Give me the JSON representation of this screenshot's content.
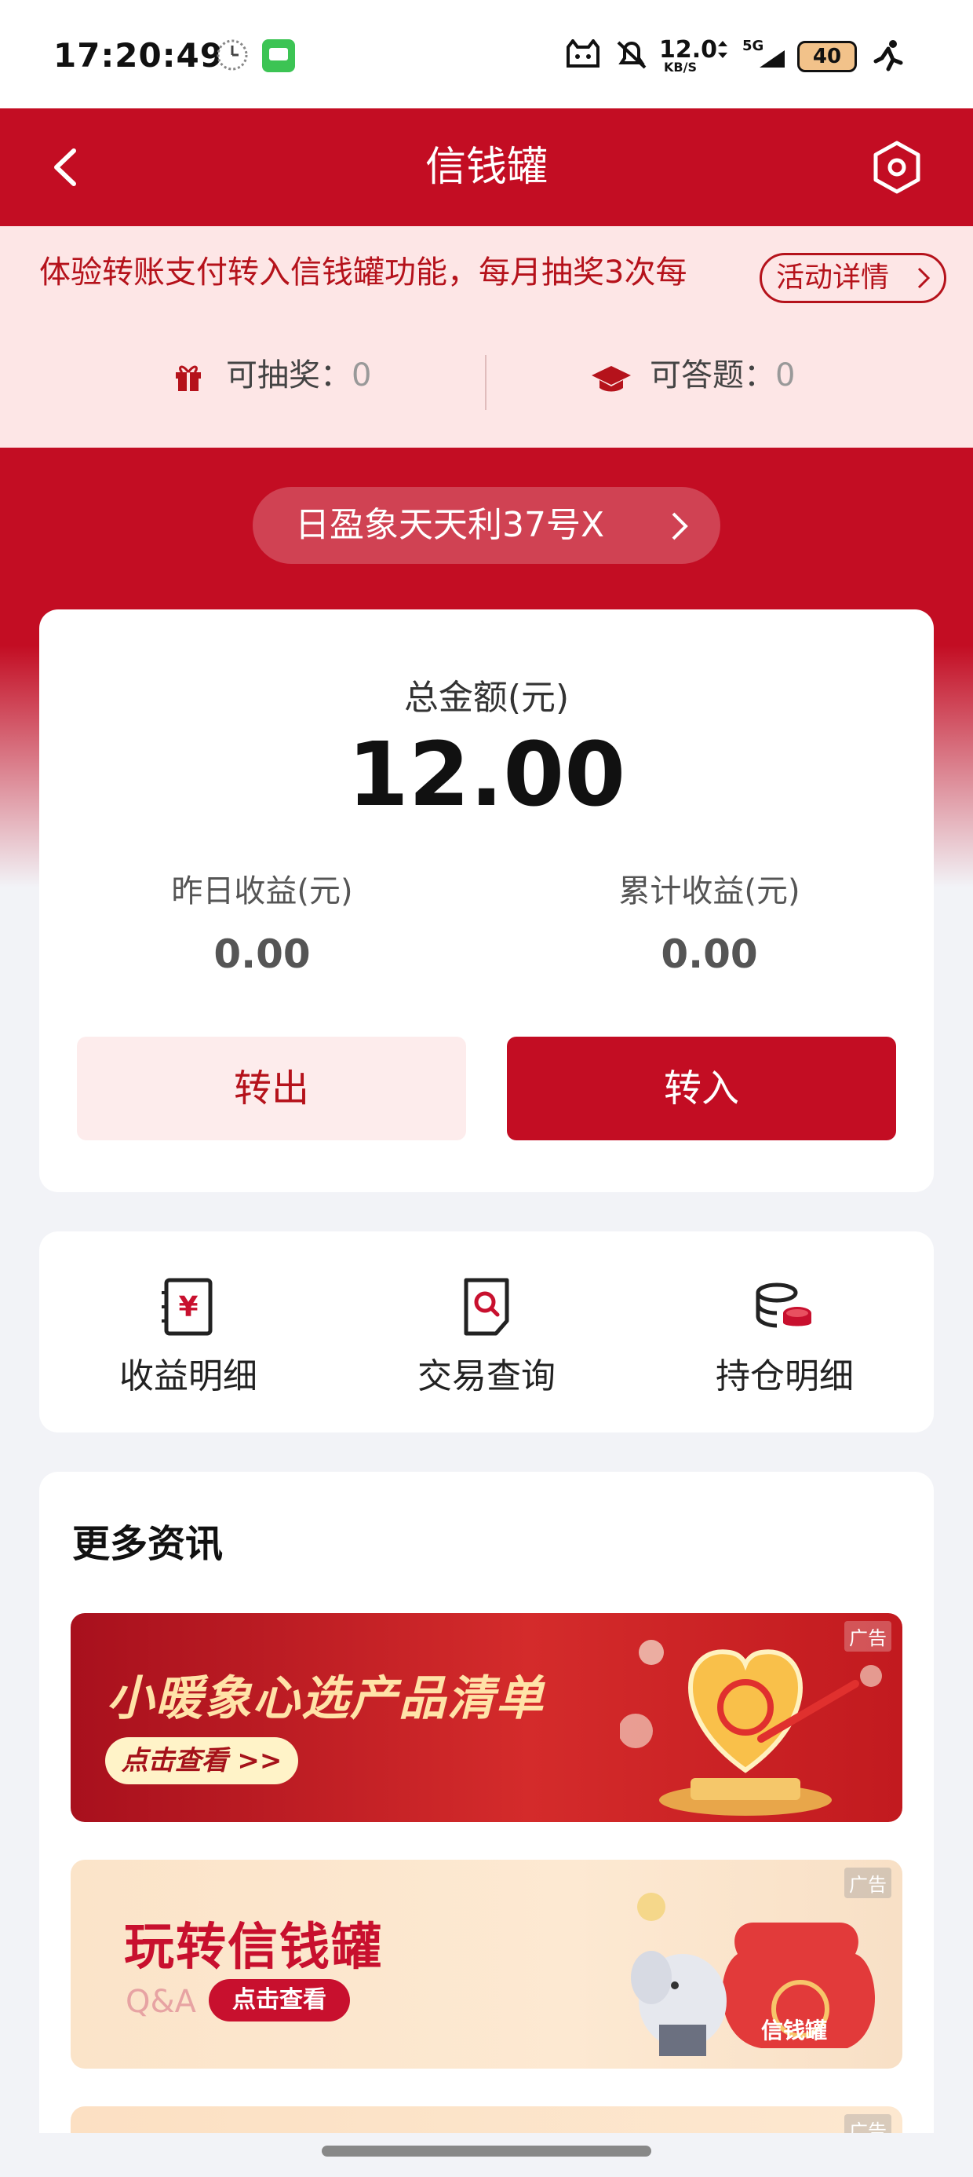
{
  "status_bar": {
    "time": "17:20:49",
    "network_speed": "12.0",
    "network_unit": "KB/S",
    "signal": "5G",
    "battery": "40"
  },
  "header": {
    "title": "信钱罐",
    "back_icon": "chevron-left-icon",
    "settings_icon": "hexagon-settings-icon"
  },
  "promo": {
    "text": "体验转账支付转入信钱罐功能，每月抽奖3次每",
    "details_label": "活动详情",
    "lottery_label": "可抽奖：",
    "lottery_count": "0",
    "quiz_label": "可答题：",
    "quiz_count": "0"
  },
  "product": {
    "name": "日盈象天天利37号X"
  },
  "summary": {
    "total_label": "总金额(元)",
    "total_value": "12.00",
    "yesterday_label": "昨日收益(元)",
    "yesterday_value": "0.00",
    "cumulative_label": "累计收益(元)",
    "cumulative_value": "0.00",
    "transfer_out_label": "转出",
    "transfer_in_label": "转入"
  },
  "tools": [
    {
      "label": "收益明细",
      "icon": "yuan-receipt-icon"
    },
    {
      "label": "交易查询",
      "icon": "search-document-icon"
    },
    {
      "label": "持仓明细",
      "icon": "coins-stack-icon"
    }
  ],
  "news": {
    "title": "更多资讯",
    "banners": [
      {
        "title": "小暖象心选产品清单",
        "button": "点击查看 >>",
        "ad_tag": "广告"
      },
      {
        "title": "玩转信钱罐",
        "subtitle": "Q&A",
        "button": "点击查看",
        "ad_tag": "广告",
        "badge": "信钱罐"
      },
      {
        "ad_tag": "广告"
      }
    ]
  },
  "colors": {
    "brand_red": "#c30d23",
    "promo_bg": "#fde6e6",
    "page_bg": "#f2f3f7"
  }
}
